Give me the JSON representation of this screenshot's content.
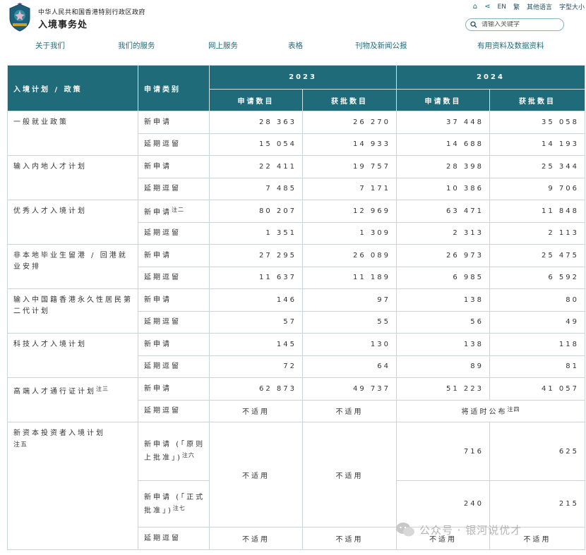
{
  "header": {
    "gov_name": "中华人民共和国香港特别行政区政府",
    "dept_name": "入境事务处",
    "toplinks": {
      "en": "EN",
      "lang_other": "繁",
      "other_languages": "其他语言",
      "font_size": "字型大小"
    },
    "search_placeholder": "请输入关键字"
  },
  "nav": [
    "关于我们",
    "我们的服务",
    "网上服务",
    "表格",
    "刊物及新闻公报",
    "有用资料及数据资料"
  ],
  "table": {
    "headers": {
      "policy": "入境计划 / 政策",
      "category": "申请类别",
      "year_2023": "2023",
      "year_2024": "2024",
      "applications": "申请数目",
      "approved": "获批数目"
    },
    "cats": {
      "new": "新申请",
      "extend": "延期逗留"
    },
    "na": "不适用",
    "rows": [
      {
        "policy": "一般就业政策",
        "new": [
          "28 363",
          "26 270",
          "37 448",
          "35 058"
        ],
        "extend": [
          "15 054",
          "14 933",
          "14 688",
          "14 193"
        ]
      },
      {
        "policy": "输入内地人才计划",
        "new": [
          "22 411",
          "19 757",
          "28 398",
          "25 344"
        ],
        "extend": [
          "7 485",
          "7 171",
          "10 386",
          "9 706"
        ]
      },
      {
        "policy": "优秀人才入境计划",
        "new_note": "注二",
        "new": [
          "80 207",
          "12 969",
          "63 471",
          "11 848"
        ],
        "extend": [
          "1 351",
          "1 309",
          "2 313",
          "2 113"
        ]
      },
      {
        "policy": "非本地毕业生留港 / 回港就业安排",
        "new": [
          "27 295",
          "26 089",
          "26 973",
          "25 475"
        ],
        "extend": [
          "11 637",
          "11 189",
          "6 985",
          "6 592"
        ]
      },
      {
        "policy": "输入中国籍香港永久性居民第二代计划",
        "new": [
          "146",
          "97",
          "138",
          "80"
        ],
        "extend": [
          "57",
          "55",
          "56",
          "49"
        ]
      },
      {
        "policy": "科技人才入境计划",
        "new": [
          "145",
          "130",
          "138",
          "118"
        ],
        "extend": [
          "72",
          "64",
          "89",
          "81"
        ]
      },
      {
        "policy": "高端人才通行证计划",
        "policy_note": "注三",
        "new": [
          "62 873",
          "49 737",
          "51 223",
          "41 057"
        ],
        "extend_2024": "将适时公布",
        "extend_2024_note": "注四"
      },
      {
        "policy": "新资本投资者入境计划",
        "policy_note": "注五",
        "new_a": "新申请 (「原则上批准」)",
        "new_a_note": "注六",
        "new_a_values": [
          "716",
          "625"
        ],
        "new_b": "新申请 (「正式批准」)",
        "new_b_note": "注七",
        "new_b_values": [
          "240",
          "215"
        ]
      }
    ]
  },
  "watermark": "公众号 · 银河说优才",
  "colors": {
    "header_bg": "#1f6b7a",
    "border": "#c9d6d8",
    "accent": "#1f6b7a"
  }
}
